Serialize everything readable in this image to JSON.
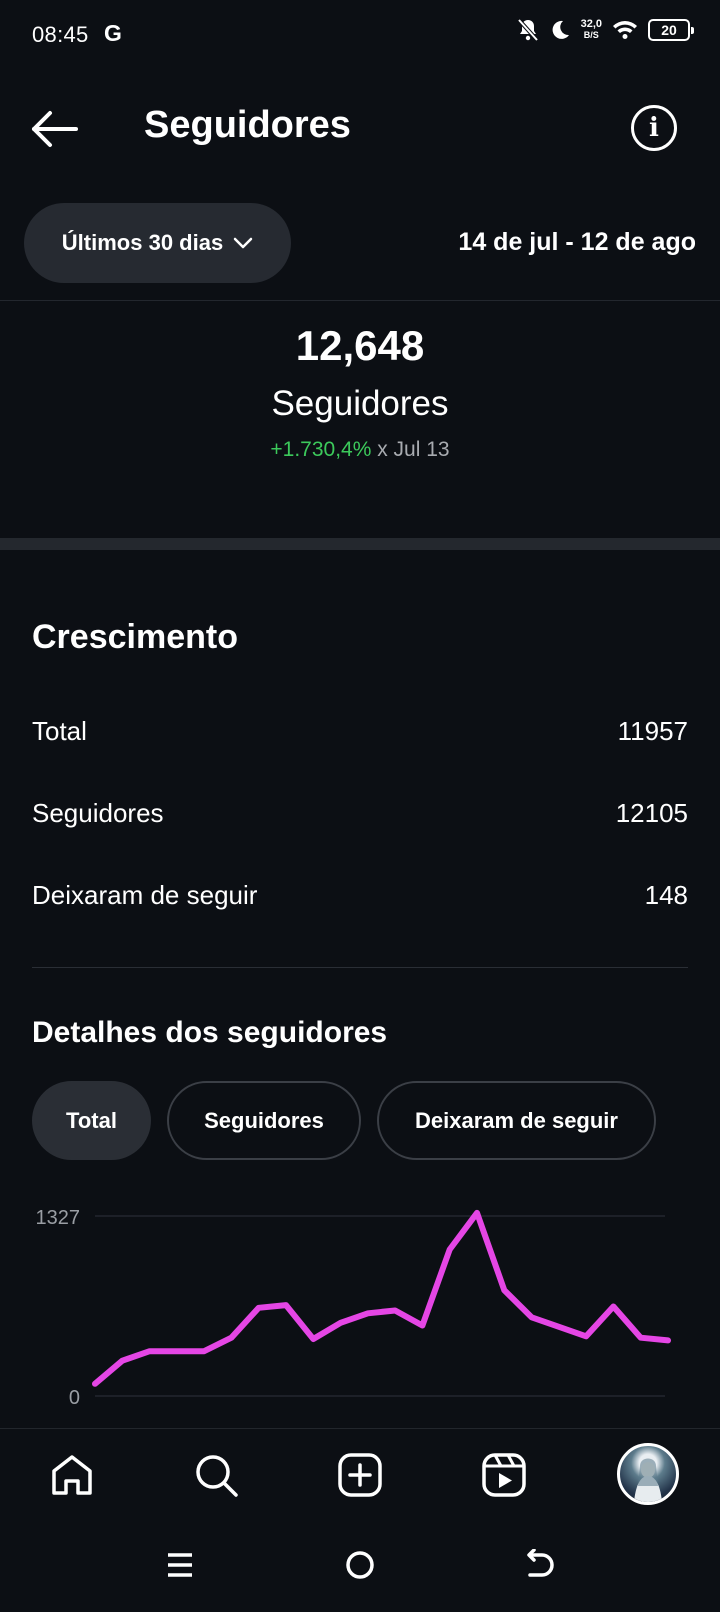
{
  "status_bar": {
    "time": "08:45",
    "carrier_icon_letter": "G",
    "net_speed_value": "32,0",
    "net_speed_unit": "B/S",
    "battery": "20"
  },
  "header": {
    "title": "Seguidores"
  },
  "range": {
    "selector_label": "Últimos 30 dias",
    "dates": "14 de jul - 12 de ago"
  },
  "summary": {
    "count": "12,648",
    "label": "Seguidores",
    "change_value": "+1.730,4%",
    "change_ref": " x Jul 13"
  },
  "growth": {
    "title": "Crescimento",
    "rows": [
      {
        "label": "Total",
        "value": "11957"
      },
      {
        "label": "Seguidores",
        "value": "12105"
      },
      {
        "label": "Deixaram de seguir",
        "value": "148"
      }
    ]
  },
  "details": {
    "title": "Detalhes dos seguidores",
    "chips": [
      {
        "label": "Total",
        "active": true
      },
      {
        "label": "Seguidores",
        "active": false
      },
      {
        "label": "Deixaram de seguir",
        "active": false
      }
    ]
  },
  "chart_data": {
    "type": "line",
    "y_tick_labels": [
      "1327",
      "0"
    ],
    "ylim": [
      0,
      1327
    ],
    "grid": true,
    "color": "#e546e5",
    "series": [
      {
        "values": [
          90,
          260,
          330,
          330,
          330,
          430,
          650,
          670,
          420,
          540,
          610,
          630,
          520,
          1080,
          1350,
          780,
          580,
          510,
          440,
          660,
          430,
          410
        ]
      }
    ]
  },
  "bottom_nav": {
    "items": [
      "home-icon",
      "search-icon",
      "create-icon",
      "reels-icon",
      "profile-avatar"
    ]
  },
  "system_nav": {
    "items": [
      "menu-icon",
      "home-circle-icon",
      "back-icon"
    ]
  },
  "colors": {
    "background": "#0c0f14",
    "positive": "#3cc95b",
    "chart_line": "#e546e5",
    "chip_active": "#2a2e35"
  }
}
